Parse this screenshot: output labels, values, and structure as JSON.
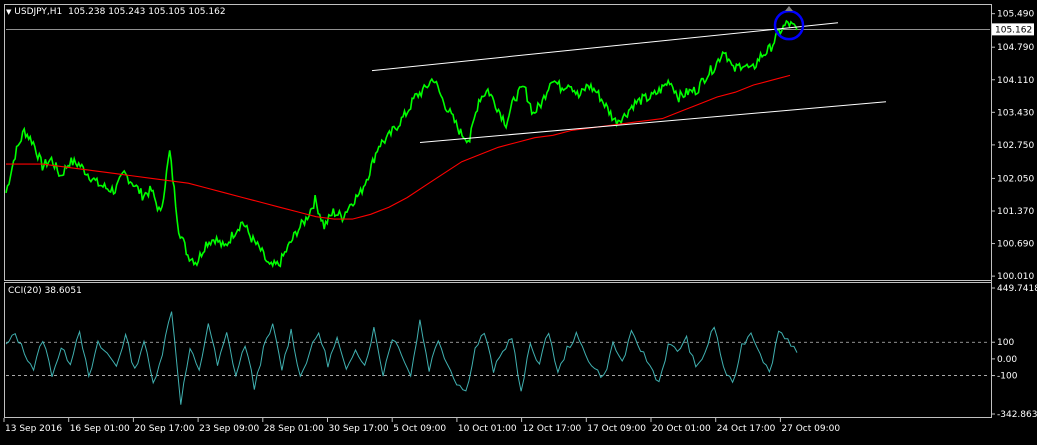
{
  "main": {
    "symbol": "USDJPY,H1",
    "ohlc": "105.238 105.243 105.105 105.162",
    "price_labels": [
      "105.490",
      "104.790",
      "104.110",
      "103.430",
      "102.750",
      "102.050",
      "101.370",
      "100.690",
      "100.010"
    ],
    "current_price": "105.162",
    "colors": {
      "price": "#00ff00",
      "ma": "#ff0000",
      "trendline": "#ffffff",
      "marker": "#0000ff",
      "bg": "#000000",
      "grid": "#c0c0c0"
    },
    "price_series": [
      101.75,
      102.55,
      103.05,
      102.8,
      102.3,
      102.45,
      102.1,
      102.4,
      102.35,
      102.15,
      101.95,
      101.85,
      101.8,
      102.15,
      101.95,
      101.7,
      101.8,
      101.3,
      102.6,
      101.0,
      100.45,
      100.3,
      100.7,
      100.8,
      100.6,
      100.9,
      101.15,
      100.8,
      100.55,
      100.2,
      100.25,
      100.6,
      100.95,
      101.2,
      101.6,
      101.05,
      101.35,
      101.25,
      101.55,
      101.75,
      102.2,
      102.75,
      102.9,
      103.15,
      103.4,
      103.75,
      103.9,
      104.15,
      103.7,
      103.35,
      103.0,
      102.85,
      103.7,
      103.9,
      103.55,
      103.2,
      103.75,
      103.95,
      103.4,
      103.65,
      104.15,
      103.95,
      104.05,
      103.75,
      104.0,
      103.85,
      103.55,
      103.25,
      103.35,
      103.6,
      103.7,
      103.75,
      103.9,
      104.1,
      103.75,
      103.85,
      103.9,
      104.2,
      104.4,
      104.75,
      104.3,
      104.45,
      104.3,
      104.6,
      104.75,
      105.1,
      105.3,
      105.15
    ],
    "ma_series": [
      102.35,
      102.35,
      102.35,
      102.3,
      102.25,
      102.2,
      102.15,
      102.1,
      102.05,
      102.0,
      101.95,
      101.85,
      101.75,
      101.65,
      101.55,
      101.45,
      101.35,
      101.25,
      101.2,
      101.2,
      101.3,
      101.45,
      101.65,
      101.9,
      102.15,
      102.4,
      102.55,
      102.7,
      102.8,
      102.9,
      102.95,
      103.05,
      103.1,
      103.15,
      103.2,
      103.25,
      103.3,
      103.45,
      103.6,
      103.75,
      103.85,
      104.0,
      104.1,
      104.2
    ],
    "trendlines": [
      {
        "from": [
          "5 Oct 09:00",
          104.3
        ],
        "to": [
          "27 Oct 09:00",
          105.3
        ]
      },
      {
        "from": [
          "7 Oct",
          102.8
        ],
        "to": [
          "29 Oct",
          103.65
        ]
      }
    ],
    "price_range": [
      99.95,
      105.65
    ]
  },
  "indicator": {
    "name": "CCI(20)",
    "value": "38.6051",
    "scale_labels": [
      "449.7418",
      "100",
      "0.00",
      "-100",
      "-342.8634"
    ],
    "levels": [
      100,
      -100
    ],
    "color": "#40b0b0",
    "range": [
      -342.8634,
      449.7418
    ],
    "series": [
      80,
      150,
      40,
      -60,
      120,
      -90,
      60,
      -20,
      180,
      -120,
      90,
      30,
      -40,
      140,
      -70,
      110,
      -150,
      40,
      300,
      -260,
      60,
      -80,
      220,
      -40,
      150,
      -100,
      90,
      -170,
      60,
      200,
      -60,
      170,
      -110,
      40,
      160,
      -30,
      120,
      -80,
      70,
      -40,
      180,
      -90,
      130,
      40,
      -100,
      230,
      -60,
      120,
      -30,
      -140,
      -200,
      60,
      160,
      -70,
      40,
      140,
      -210,
      90,
      -30,
      170,
      -90,
      60,
      140,
      30,
      -60,
      -110,
      90,
      -20,
      150,
      60,
      -40,
      -140,
      80,
      50,
      120,
      -60,
      40,
      200,
      -50,
      -160,
      80,
      160,
      40,
      -90,
      170,
      120,
      38
    ]
  },
  "time_labels": [
    "13 Sep 2016",
    "16 Sep 01:00",
    "20 Sep 17:00",
    "23 Sep 09:00",
    "28 Sep 01:00",
    "30 Sep 17:00",
    "5 Oct 09:00",
    "10 Oct 01:00",
    "12 Oct 17:00",
    "17 Oct 09:00",
    "20 Oct 01:00",
    "24 Oct 17:00",
    "27 Oct 09:00"
  ]
}
